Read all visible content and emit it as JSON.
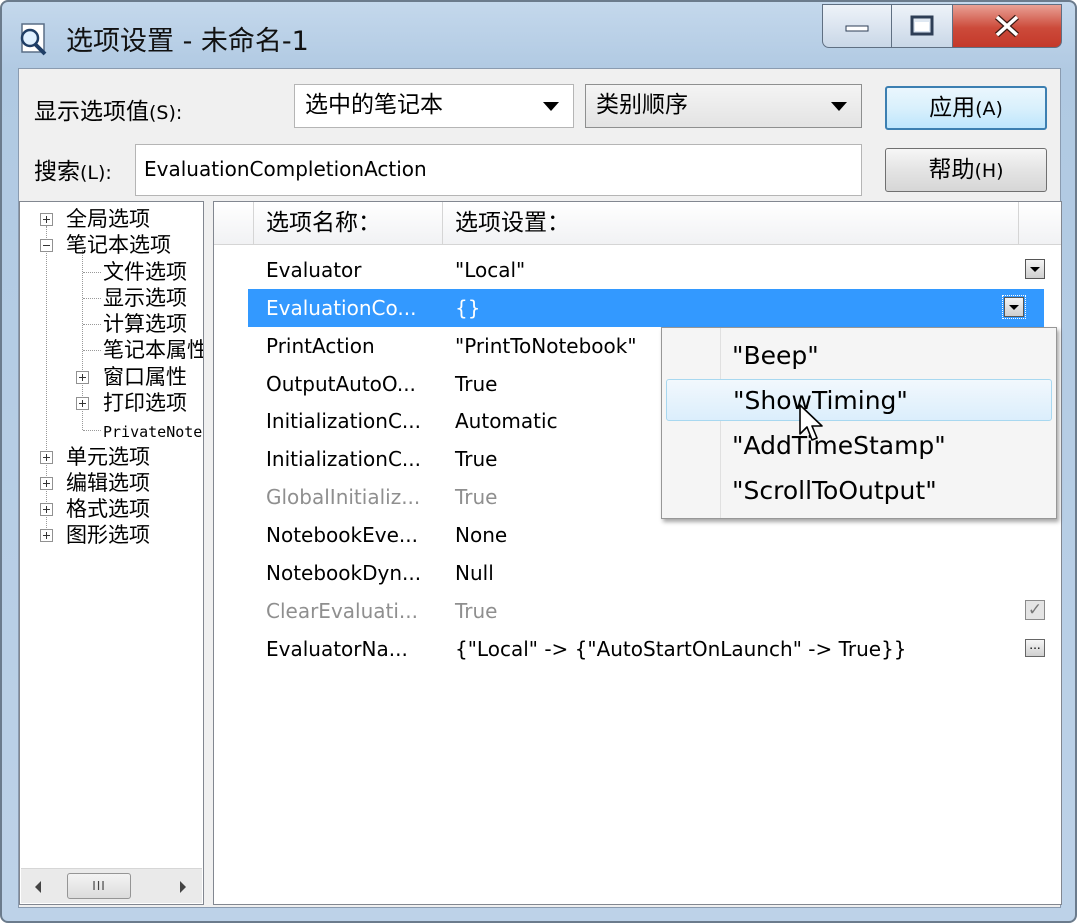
{
  "window": {
    "title": "选项设置 - 未命名-1"
  },
  "toolbar": {
    "show_label": "显示选项值",
    "show_accel": "(S):",
    "scope_value": "选中的笔记本",
    "order_value": "类别顺序",
    "search_label": "搜索",
    "search_accel": "(L):",
    "search_value": "EvaluationCompletionAction",
    "apply_label": "应用",
    "apply_accel": "(A)",
    "help_label": "帮助",
    "help_accel": "(H)"
  },
  "tree": {
    "nodes": [
      "全局选项",
      "笔记本选项",
      "文件选项",
      "显示选项",
      "计算选项",
      "笔记本属性",
      "窗口属性",
      "打印选项",
      "PrivateNotebookOptions",
      "单元选项",
      "编辑选项",
      "格式选项",
      "图形选项"
    ],
    "scroll_thumb": "III"
  },
  "grid": {
    "col_name": "选项名称：",
    "col_value": "选项设置：",
    "rows": [
      {
        "name": "Evaluator",
        "value": "\"Local\""
      },
      {
        "name": "EvaluationCo...",
        "value": "{}"
      },
      {
        "name": "PrintAction",
        "value": "\"PrintToNotebook\""
      },
      {
        "name": "OutputAutoO...",
        "value": "True"
      },
      {
        "name": "InitializationC...",
        "value": "Automatic"
      },
      {
        "name": "InitializationC...",
        "value": "True"
      },
      {
        "name": "GlobalInitializ...",
        "value": "True"
      },
      {
        "name": "NotebookEve...",
        "value": "None"
      },
      {
        "name": "NotebookDyn...",
        "value": "Null"
      },
      {
        "name": "ClearEvaluati...",
        "value": "True"
      },
      {
        "name": "EvaluatorNa...",
        "value": "{\"Local\" -> {\"AutoStartOnLaunch\" -> True}}"
      }
    ]
  },
  "popup": {
    "items": [
      "\"Beep\"",
      "\"ShowTiming\"",
      "\"AddTimeStamp\"",
      "\"ScrollToOutput\""
    ]
  },
  "colors": {
    "selection": "#3399ff",
    "close_button": "#c4392a"
  }
}
